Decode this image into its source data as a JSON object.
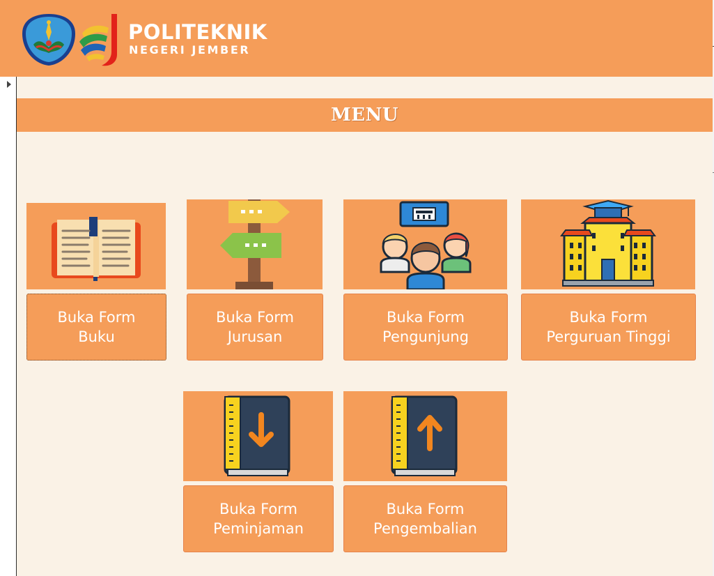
{
  "header": {
    "brand_line1": "POLITEKNIK",
    "brand_line2": "NEGERI JEMBER",
    "logos": [
      "institution-seal-icon",
      "polije-mark-icon"
    ]
  },
  "menu": {
    "title": "MENU"
  },
  "tiles": [
    {
      "icon": "open-book-icon",
      "label_line1": "Buka Form",
      "label_line2": "Buku"
    },
    {
      "icon": "signpost-icon",
      "label_line1": "Buka Form",
      "label_line2": "Jurusan"
    },
    {
      "icon": "visitors-icon",
      "label_line1": "Buka Form",
      "label_line2": "Pengunjung"
    },
    {
      "icon": "university-building-icon",
      "label_line1": "Buka Form",
      "label_line2": "Perguruan Tinggi"
    },
    {
      "icon": "book-down-arrow-icon",
      "label_line1": "Buka Form",
      "label_line2": "Peminjaman"
    },
    {
      "icon": "book-up-arrow-icon",
      "label_line1": "Buka Form",
      "label_line2": "Pengembalian"
    }
  ],
  "colors": {
    "accent": "#F59D59",
    "background": "#FAF2E6",
    "text": "#FFFFFF"
  }
}
